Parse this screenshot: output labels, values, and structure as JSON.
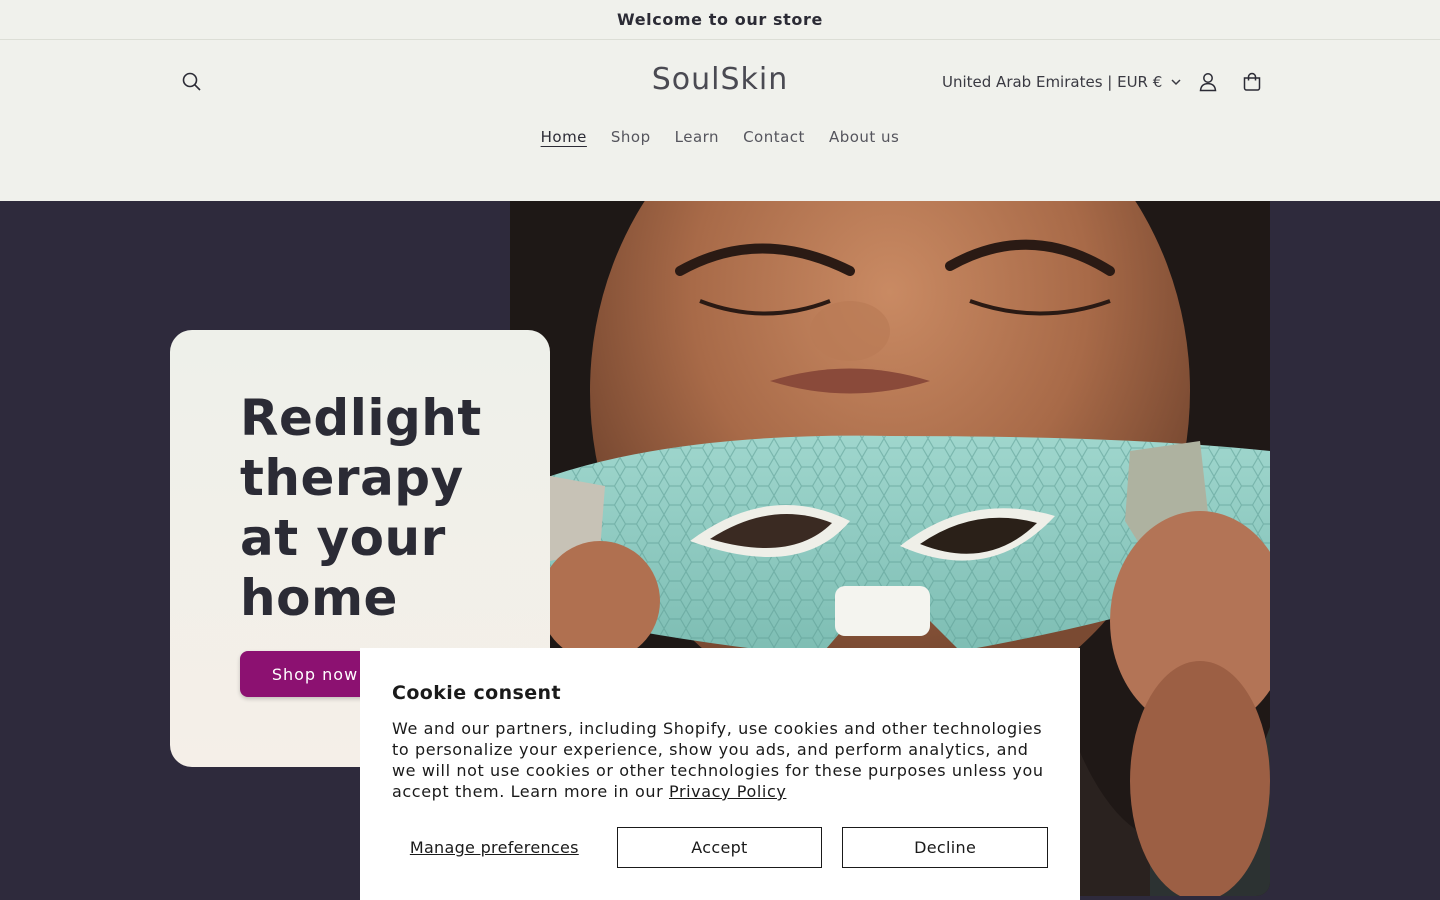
{
  "announcement": {
    "text": "Welcome to our store"
  },
  "header": {
    "logo": "SoulSkin",
    "country_selector": "United Arab Emirates | EUR €",
    "nav": [
      {
        "label": "Home",
        "active": true
      },
      {
        "label": "Shop",
        "active": false
      },
      {
        "label": "Learn",
        "active": false
      },
      {
        "label": "Contact",
        "active": false
      },
      {
        "label": "About us",
        "active": false
      }
    ],
    "icons": [
      "search-icon",
      "chevron-down-icon",
      "account-icon",
      "cart-icon"
    ]
  },
  "hero": {
    "heading_lines": [
      "Redlight",
      "therapy",
      "at your",
      "home"
    ],
    "button_label": "Shop now",
    "image": "woman-holding-led-eye-mask",
    "colors": {
      "background": "#2e2a3c",
      "card": "#eef0ea",
      "button": "#8c1171",
      "mask": "#8cc9c0"
    }
  },
  "cookie_banner": {
    "title": "Cookie consent",
    "body": "We and our partners, including Shopify, use cookies and other technologies to personalize your experience, show you ads, and perform analytics, and we will not use cookies or other technologies for these purposes unless you accept them. Learn more in our ",
    "policy_link": "Privacy Policy",
    "manage_label": "Manage preferences",
    "accept_label": "Accept",
    "decline_label": "Decline"
  }
}
